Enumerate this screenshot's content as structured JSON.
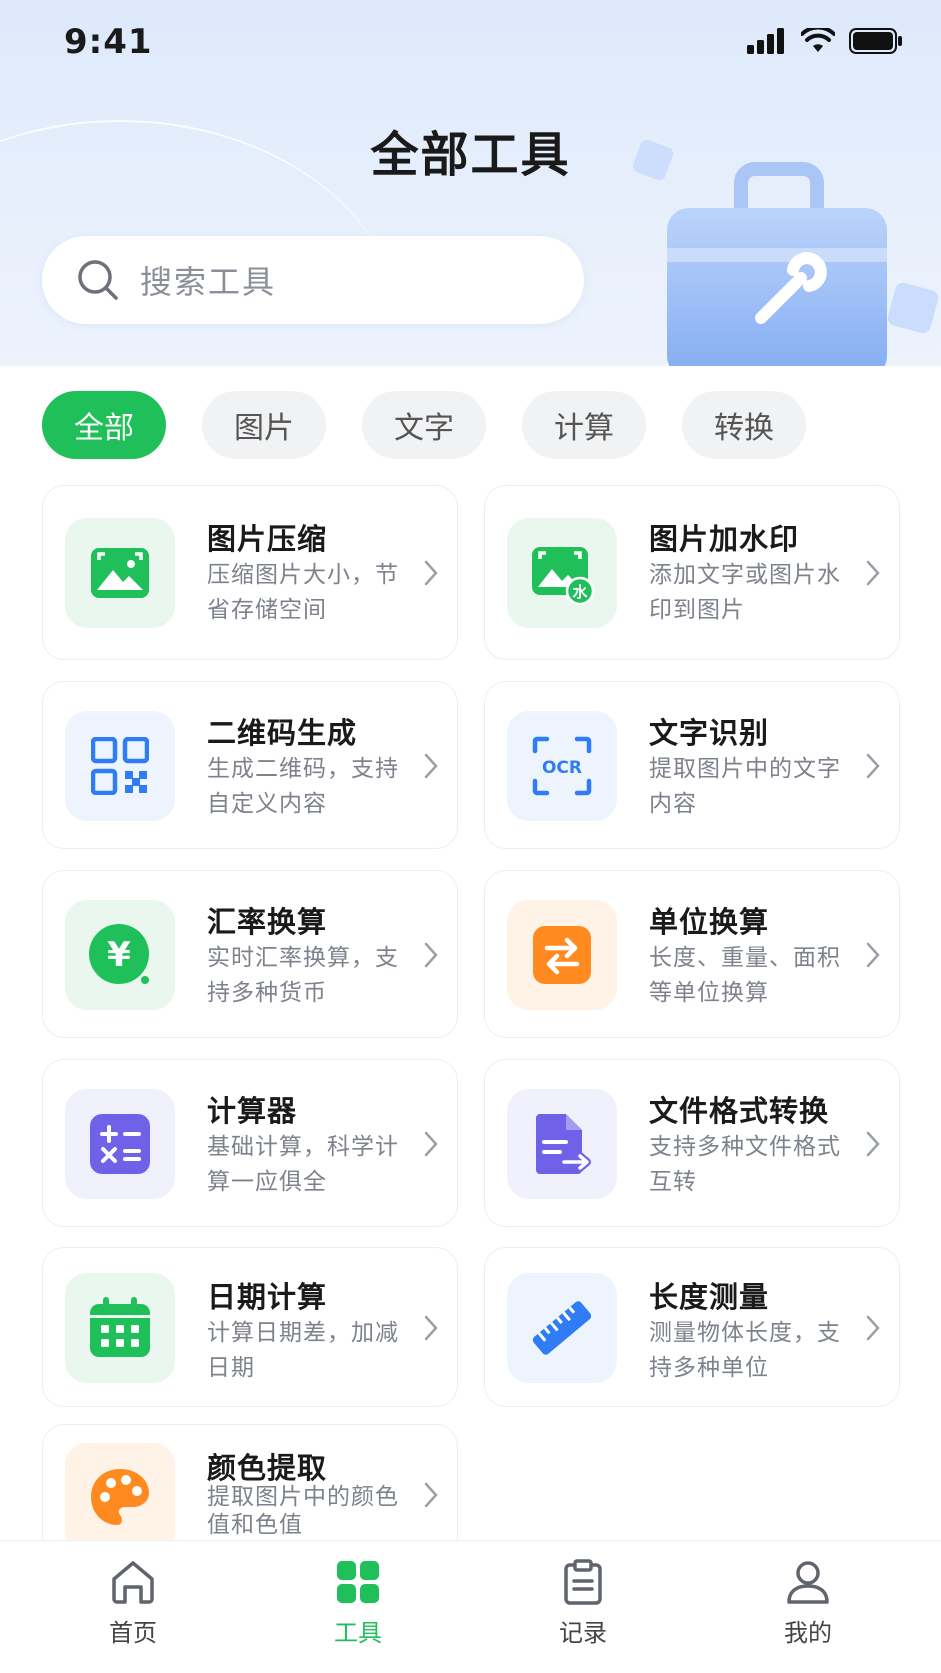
{
  "status": {
    "time": "9:41"
  },
  "header": {
    "title": "全部工具",
    "search_placeholder": "搜索工具"
  },
  "filters": [
    {
      "label": "全部",
      "active": true
    },
    {
      "label": "图片",
      "active": false
    },
    {
      "label": "文字",
      "active": false
    },
    {
      "label": "计算",
      "active": false
    },
    {
      "label": "转换",
      "active": false
    }
  ],
  "tools": [
    {
      "title": "图片压缩",
      "desc": "压缩图片大小，节省存储空间",
      "icon": "image-icon"
    },
    {
      "title": "图片加水印",
      "desc": "添加文字或图片水印到图片",
      "icon": "watermark-icon"
    },
    {
      "title": "二维码生成",
      "desc": "生成二维码，支持自定义内容",
      "icon": "qr-code-icon"
    },
    {
      "title": "文字识别",
      "desc": "提取图片中的文字内容",
      "icon": "ocr-icon",
      "icon_text": "OCR"
    },
    {
      "title": "汇率换算",
      "desc": "实时汇率换算，支持多种货币",
      "icon": "currency-icon",
      "icon_text": "¥"
    },
    {
      "title": "单位换算",
      "desc": "长度、重量、面积等单位换算",
      "icon": "swap-icon"
    },
    {
      "title": "计算器",
      "desc": "基础计算，科学计算一应俱全",
      "icon": "calculator-icon"
    },
    {
      "title": "文件格式转换",
      "desc": "支持多种文件格式互转",
      "icon": "file-convert-icon"
    },
    {
      "title": "日期计算",
      "desc": "计算日期差，加减日期",
      "icon": "calendar-icon"
    },
    {
      "title": "长度测量",
      "desc": "测量物体长度，支持多种单位",
      "icon": "ruler-icon"
    },
    {
      "title": "颜色提取",
      "desc": "提取图片中的颜色值和色值",
      "icon": "palette-icon"
    }
  ],
  "watermark_badge": "水",
  "tabbar": [
    {
      "label": "首页",
      "icon": "home-icon",
      "active": false
    },
    {
      "label": "工具",
      "icon": "grid-icon",
      "active": true
    },
    {
      "label": "记录",
      "icon": "clipboard-icon",
      "active": false
    },
    {
      "label": "我的",
      "icon": "user-icon",
      "active": false
    }
  ],
  "colors": {
    "accent": "#1fbf5a",
    "blue": "#2f7cf6",
    "orange": "#ff8a1f",
    "purple": "#6f62e8"
  }
}
